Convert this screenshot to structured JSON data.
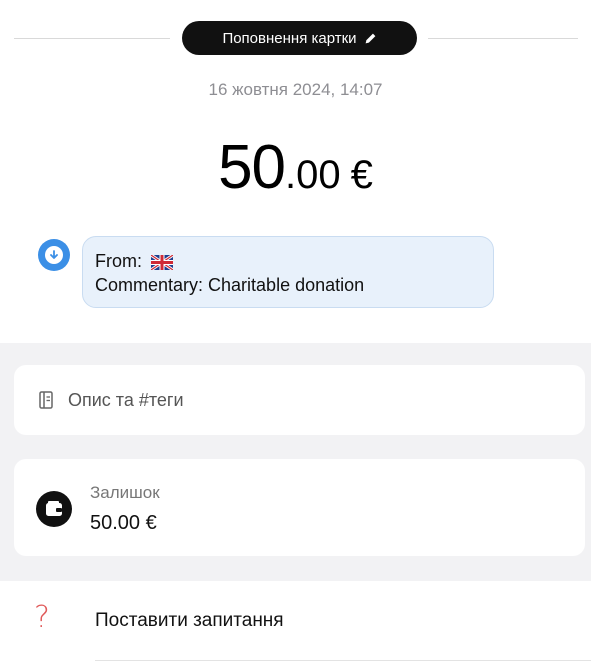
{
  "header": {
    "category_label": "Поповнення картки",
    "category_icon": "pencil-icon"
  },
  "transaction": {
    "datetime": "16 жовтня 2024, 14:07",
    "amount_int": "50",
    "amount_dec": ".00",
    "currency": "€"
  },
  "message": {
    "icon": "incoming-arrow-icon",
    "from_label": "From:",
    "flag_icon": "uk-flag-icon",
    "commentary": "Commentary: Charitable donation",
    "accent_color": "#3b8fe6"
  },
  "description": {
    "icon": "notebook-icon",
    "label": "Опис та #теги"
  },
  "balance": {
    "icon": "wallet-icon",
    "title": "Залишок",
    "value": "50.00 €"
  },
  "question": {
    "icon": "question-mark-icon",
    "label": "Поставити запитання",
    "icon_color": "#e05a5a"
  }
}
